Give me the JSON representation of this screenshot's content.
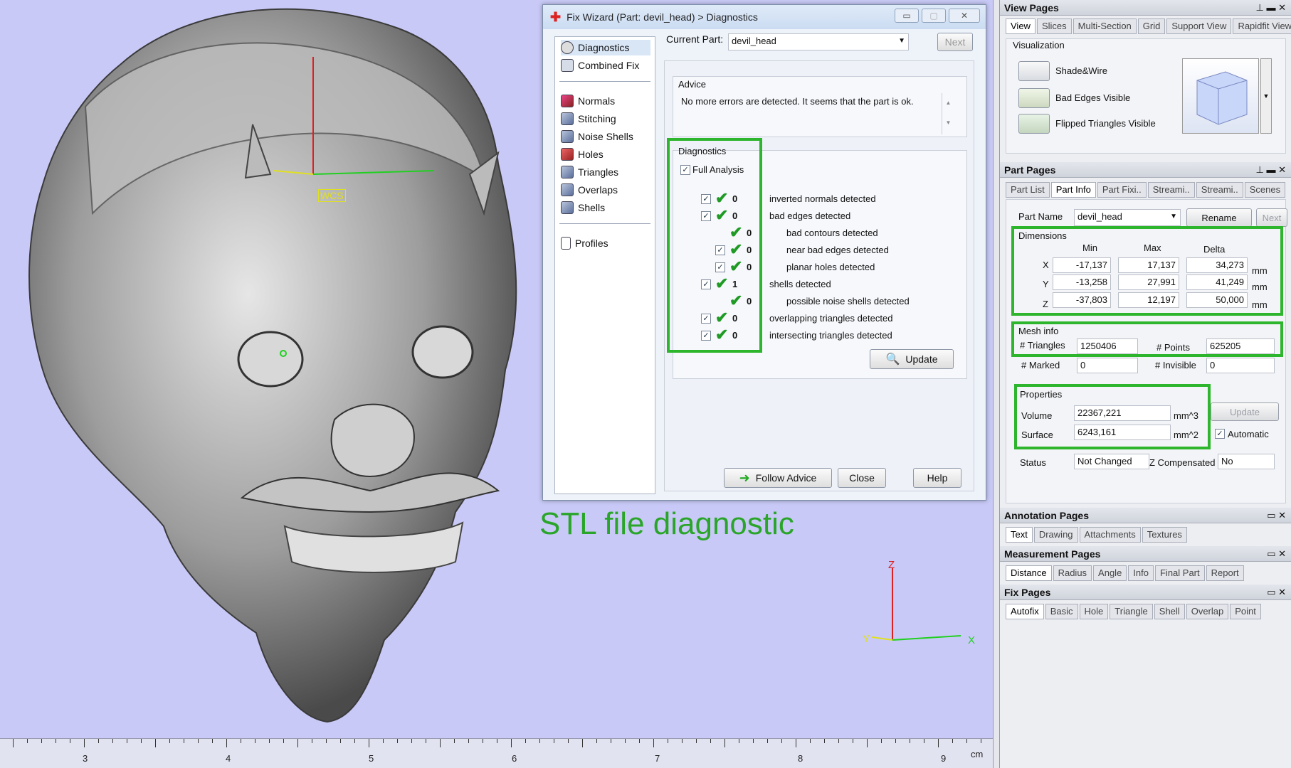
{
  "viewport": {
    "caption": "STL file diagnostic",
    "wcs_label": "WCS",
    "axis_x": "X",
    "axis_y": "Y",
    "axis_z": "Z",
    "ruler_unit": "cm",
    "ruler_labels": [
      "3",
      "4",
      "5",
      "6",
      "7",
      "8",
      "9"
    ]
  },
  "wizard": {
    "title": "Fix Wizard (Part: devil_head) > Diagnostics",
    "nav": {
      "diagnostics": "Diagnostics",
      "combined_fix": "Combined Fix",
      "normals": "Normals",
      "stitching": "Stitching",
      "noise_shells": "Noise Shells",
      "holes": "Holes",
      "triangles": "Triangles",
      "overlaps": "Overlaps",
      "shells": "Shells",
      "profiles": "Profiles"
    },
    "current_part_label": "Current Part:",
    "current_part_value": "devil_head",
    "next_label": "Next",
    "advice_label": "Advice",
    "advice_text": "No more errors are detected. It seems that the part is ok.",
    "diagnostics_label": "Diagnostics",
    "full_analysis": "Full Analysis",
    "rows": [
      {
        "count": "0",
        "text": "inverted normals detected"
      },
      {
        "count": "0",
        "text": "bad edges detected"
      },
      {
        "count": "0",
        "text": "bad contours detected"
      },
      {
        "count": "0",
        "text": "near bad edges detected"
      },
      {
        "count": "0",
        "text": "planar holes detected"
      },
      {
        "count": "1",
        "text": "shells detected"
      },
      {
        "count": "0",
        "text": "possible noise shells detected"
      },
      {
        "count": "0",
        "text": "overlapping triangles detected"
      },
      {
        "count": "0",
        "text": "intersecting triangles detected"
      }
    ],
    "update_label": "Update",
    "follow_advice": "Follow Advice",
    "close": "Close",
    "help": "Help"
  },
  "view_pages": {
    "title": "View Pages",
    "tabs": [
      "View",
      "Slices",
      "Multi-Section",
      "Grid",
      "Support View",
      "Rapidfit View"
    ],
    "visualization": "Visualization",
    "shade_wire": "Shade&Wire",
    "bad_edges": "Bad Edges Visible",
    "flipped": "Flipped Triangles Visible"
  },
  "part_pages": {
    "title": "Part Pages",
    "tabs": [
      "Part List",
      "Part Info",
      "Part Fixi..",
      "Streami..",
      "Streami..",
      "Scenes"
    ],
    "part_name_label": "Part Name",
    "part_name_value": "devil_head",
    "rename": "Rename",
    "next": "Next",
    "dimensions": "Dimensions",
    "min": "Min",
    "max": "Max",
    "delta": "Delta",
    "mm": "mm",
    "x": {
      "label": "X",
      "min": "-17,137",
      "max": "17,137",
      "delta": "34,273"
    },
    "y": {
      "label": "Y",
      "min": "-13,258",
      "max": "27,991",
      "delta": "41,249"
    },
    "z": {
      "label": "Z",
      "min": "-37,803",
      "max": "12,197",
      "delta": "50,000"
    },
    "mesh_info": "Mesh info",
    "triangles_label": "# Triangles",
    "triangles_value": "1250406",
    "points_label": "# Points",
    "points_value": "625205",
    "marked_label": "# Marked",
    "marked_value": "0",
    "invisible_label": "# Invisible",
    "invisible_value": "0",
    "properties": "Properties",
    "volume_label": "Volume",
    "volume_value": "22367,221",
    "volume_unit": "mm^3",
    "surface_label": "Surface",
    "surface_value": "6243,161",
    "surface_unit": "mm^2",
    "update": "Update",
    "automatic": "Automatic",
    "status_label": "Status",
    "status_value": "Not Changed",
    "zcomp_label": "Z Compensated",
    "zcomp_value": "No"
  },
  "annotation_pages": {
    "title": "Annotation Pages",
    "tabs": [
      "Text",
      "Drawing",
      "Attachments",
      "Textures"
    ]
  },
  "measurement_pages": {
    "title": "Measurement Pages",
    "tabs": [
      "Distance",
      "Radius",
      "Angle",
      "Info",
      "Final Part",
      "Report"
    ]
  },
  "fix_pages": {
    "title": "Fix Pages",
    "tabs": [
      "Autofix",
      "Basic",
      "Hole",
      "Triangle",
      "Shell",
      "Overlap",
      "Point"
    ]
  },
  "colors": {
    "highlight_green": "#2db52d",
    "viewport_bg": "#c8c9f6",
    "caption_green": "#2aa52a"
  }
}
